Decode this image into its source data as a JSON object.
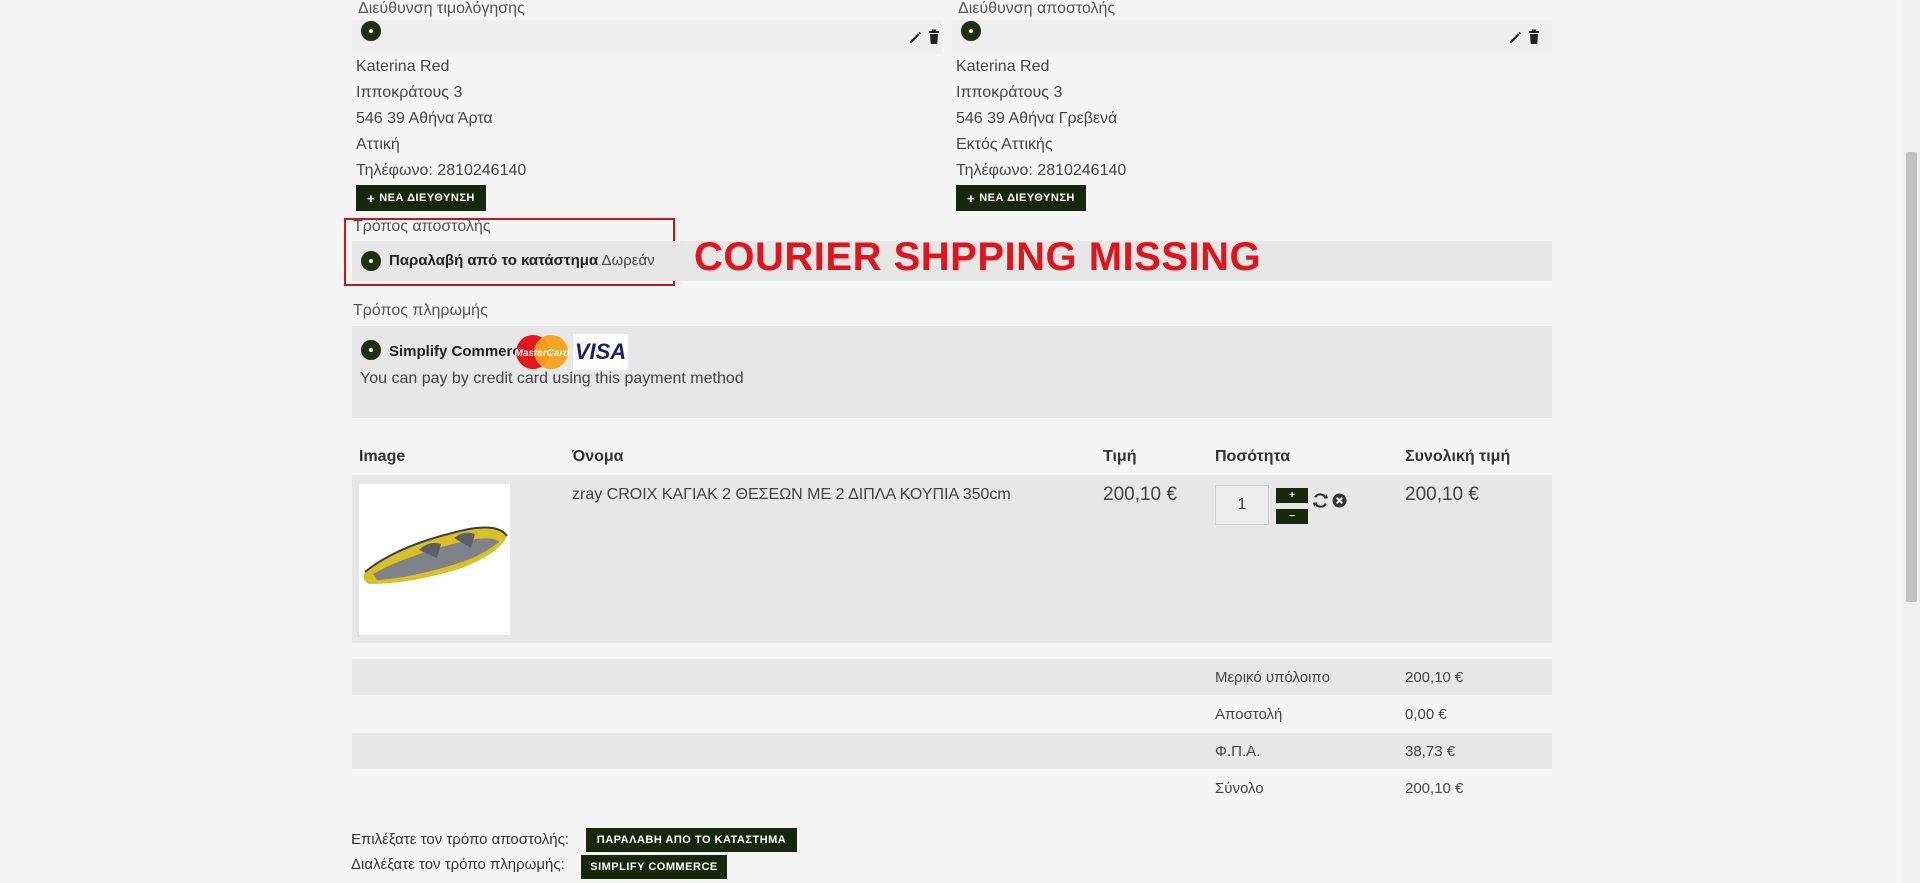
{
  "billing": {
    "title": "Διεύθυνση τιμολόγησης",
    "name": "Katerina Red",
    "street": "Ιπποκράτους 3",
    "city": "546 39 Αθήνα Άρτα",
    "region": "Αττική",
    "phone": "Τηλέφωνο: 2810246140",
    "new_button": "ΝΕΑ ΔΙΕΥΘΥΝΣΗ"
  },
  "shipping_address": {
    "title": "Διεύθυνση αποστολής",
    "name": "Katerina Red",
    "street": "Ιπποκράτους 3",
    "city": "546 39 Αθήνα Γρεβενά",
    "region": "Εκτός Αττικής",
    "phone": "Τηλέφωνο: 2810246140",
    "new_button": "ΝΕΑ ΔΙΕΥΘΥΝΣΗ"
  },
  "shipping_method": {
    "title": "Τρόπος αποστολής",
    "option_label": "Παραλαβή από το κατάστημα",
    "option_price": "Δωρεάν",
    "annotation": "COURIER SHPPING MISSING"
  },
  "payment_method": {
    "title": "Τρόπος πληρωμής",
    "option_label": "Simplify Commerce",
    "mastercard_text": "MasterCard",
    "visa_text": "VISA",
    "description": "You can pay by credit card using this payment method"
  },
  "cart": {
    "headers": {
      "image": "Image",
      "name": "Όνομα",
      "price": "Τιμή",
      "quantity": "Ποσότητα",
      "total": "Συνολική τιμή"
    },
    "items": [
      {
        "name": "zray CROIX ΚΑΓΙΑΚ 2 ΘΕΣΕΩΝ ΜΕ 2 ΔΙΠΛΑ ΚΟΥΠΙΑ 350cm",
        "price": "200,10 €",
        "quantity": "1",
        "total": "200,10 €",
        "plus": "+",
        "minus": "−"
      }
    ],
    "totals": [
      {
        "label": "Μερικό υπόλοιπο",
        "value": "200,10 €"
      },
      {
        "label": "Αποστολή",
        "value": "0,00 €"
      },
      {
        "label": "Φ.Π.Α.",
        "value": "38,73 €"
      },
      {
        "label": "Σύνολο",
        "value": "200,10 €"
      }
    ]
  },
  "footer": {
    "shipping_prompt": "Επιλέξατε τον τρόπο αποστολής:",
    "shipping_choice": "ΠΑΡΑΛΑΒΗ ΑΠΟ ΤΟ ΚΑΤΑΣΤΗΜΑ",
    "payment_prompt": "Διαλέξατε τον τρόπο πληρωμής:",
    "payment_choice": "SIMPLIFY COMMERCE"
  },
  "colors": {
    "accent_dark": "#17270c",
    "annotation_red": "#e0141a"
  }
}
